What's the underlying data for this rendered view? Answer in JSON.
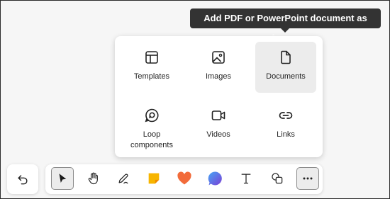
{
  "tooltip": {
    "text": "Add PDF or PowerPoint document as image"
  },
  "menu": {
    "items": [
      {
        "label": "Templates",
        "icon": "templates-icon"
      },
      {
        "label": "Images",
        "icon": "image-icon"
      },
      {
        "label": "Documents",
        "icon": "document-icon",
        "selected": true
      },
      {
        "label": "Loop\ncomponents",
        "icon": "loop-icon"
      },
      {
        "label": "Videos",
        "icon": "video-icon"
      },
      {
        "label": "Links",
        "icon": "link-icon"
      }
    ]
  },
  "toolbar": {
    "undo_icon": "undo-icon",
    "tools": [
      {
        "icon": "select-pointer-icon",
        "active": true
      },
      {
        "icon": "hand-pan-icon"
      },
      {
        "icon": "pen-icon"
      },
      {
        "icon": "sticky-note-icon",
        "color": "#f7b500"
      },
      {
        "icon": "heart-reaction-icon",
        "color": "#f26b3a"
      },
      {
        "icon": "comment-icon",
        "color": "#2f6fe0"
      },
      {
        "icon": "text-icon"
      },
      {
        "icon": "shapes-icon"
      },
      {
        "icon": "more-icon",
        "active": true
      }
    ]
  },
  "colors": {
    "tooltip_bg": "#333333",
    "selected_bg": "#ececec"
  }
}
